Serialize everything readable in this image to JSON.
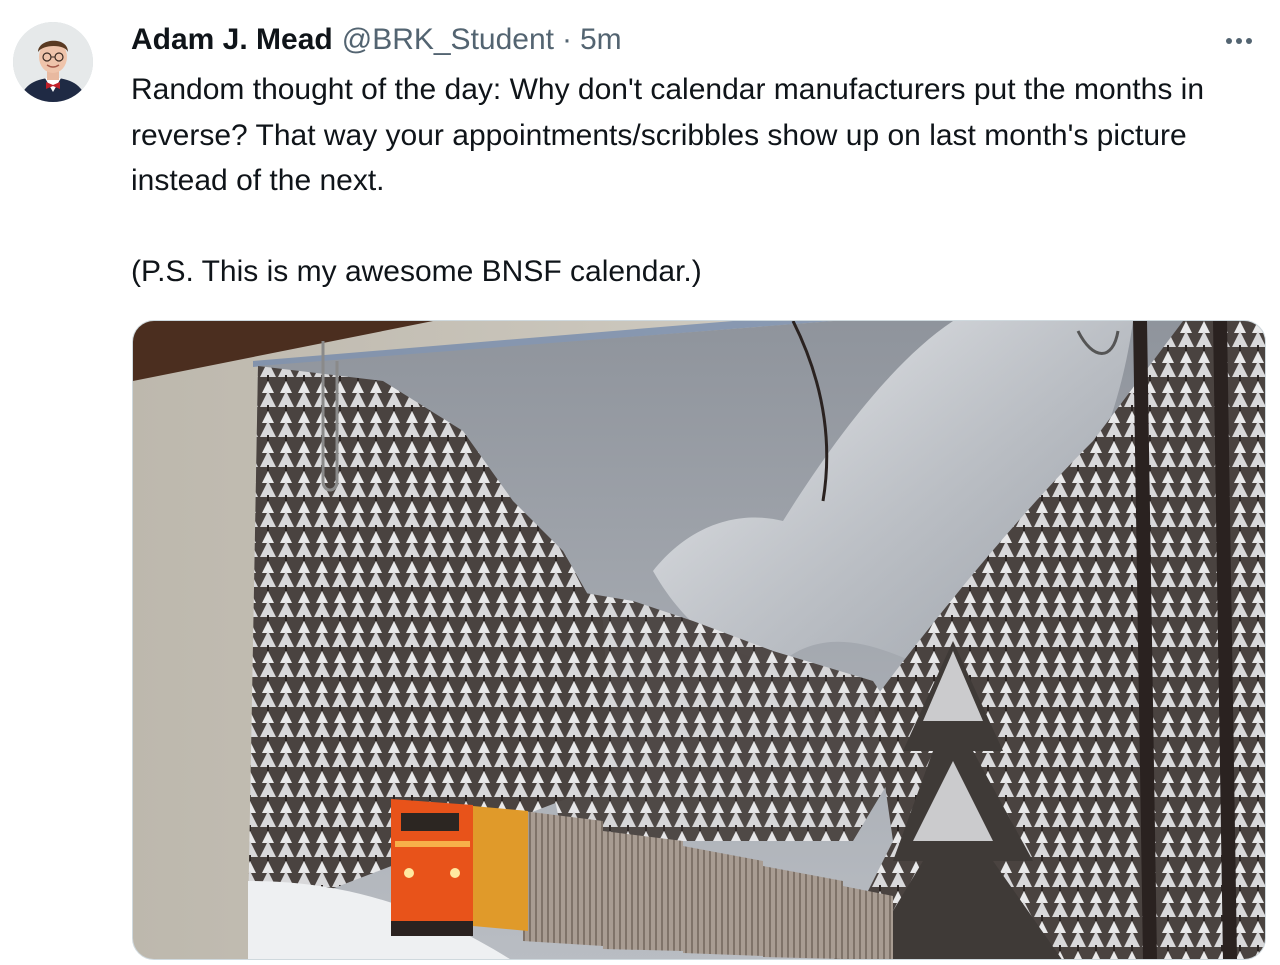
{
  "tweet": {
    "author": {
      "display_name": "Adam J. Mead",
      "handle": "@BRK_Student",
      "avatar_icon": "profile-avatar"
    },
    "separator": "·",
    "timestamp": "5m",
    "more_icon": "more-options-icon",
    "text": "Random thought of the day: Why don't calendar manufacturers put the months in reverse? That way your appointments/scribbles show up on last month's picture instead of the next.\n\n(P.S. This is my awesome BNSF calendar.)",
    "media": {
      "type": "photo",
      "subject": "calendar-photo-train-snowy-forest",
      "colors": {
        "wall": "#d9d6cf",
        "sky": "#9ea3ab",
        "locomotive": "#e8531a",
        "snow": "#f2f3f5"
      }
    }
  }
}
